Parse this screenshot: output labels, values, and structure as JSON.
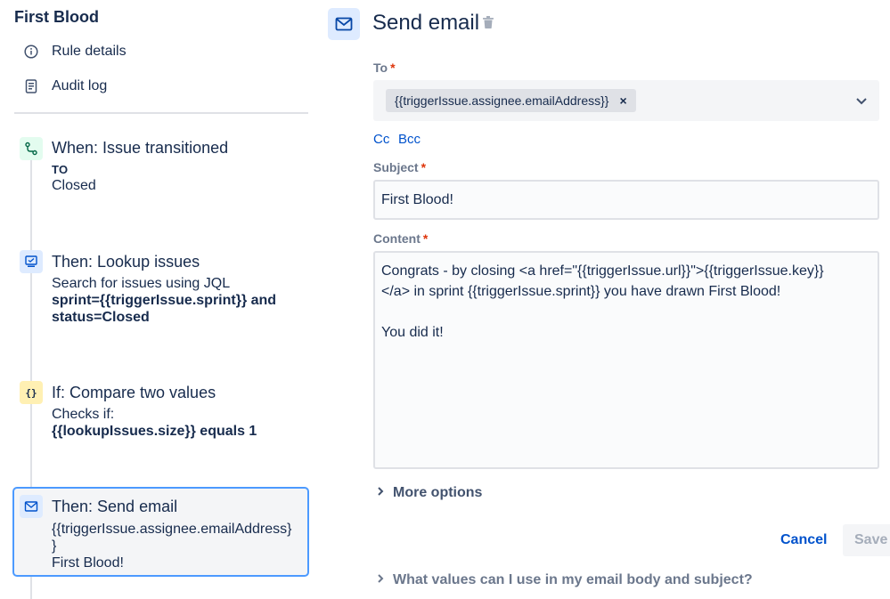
{
  "rule": {
    "title": "First Blood",
    "nav": [
      {
        "label": "Rule details",
        "icon": "info-icon"
      },
      {
        "label": "Audit log",
        "icon": "document-icon"
      }
    ]
  },
  "steps": [
    {
      "title": "When: Issue transitioned",
      "icon": "branch-icon",
      "lines": [
        "TO",
        "Closed"
      ]
    },
    {
      "title": "Then: Lookup issues",
      "icon": "screen-icon",
      "lines": [
        "Search for issues using JQL",
        "sprint={{triggerIssue.sprint}} and",
        "status=Closed"
      ]
    },
    {
      "title": "If: Compare two values",
      "icon": "curly-braces-icon",
      "icon_text": "{}",
      "lines": [
        "Checks if:",
        "{{lookupIssues.size}} equals 1"
      ]
    },
    {
      "title": "Then: Send email",
      "icon": "envelope-icon",
      "lines": [
        "{{triggerIssue.assignee.emailAddress}",
        "}",
        "First Blood!"
      ]
    }
  ],
  "editor": {
    "title": "Send email",
    "required_mark": "*",
    "to_label": "To",
    "to_value": "{{triggerIssue.assignee.emailAddress}}",
    "chip_remove": "×",
    "cc_label": "Cc",
    "bcc_label": "Bcc",
    "subject_label": "Subject",
    "subject_value": "First Blood!",
    "content_label": "Content",
    "content_value": "Congrats - by closing <a href=\"{{triggerIssue.url}}\">{{triggerIssue.key}}\n</a> in sprint {{triggerIssue.sprint}} you have drawn First Blood!\n\nYou did it!",
    "more_options_label": "More options",
    "cancel_label": "Cancel",
    "save_label": "Save",
    "help_label": "What values can I use in my email body and subject?"
  },
  "colors": {
    "link": "#0052cc",
    "selected_border": "#4c9aff",
    "required": "#de350b",
    "trigger_bg": "#e3fcef",
    "action_bg": "#deebff",
    "condition_bg": "#fff0b3"
  }
}
